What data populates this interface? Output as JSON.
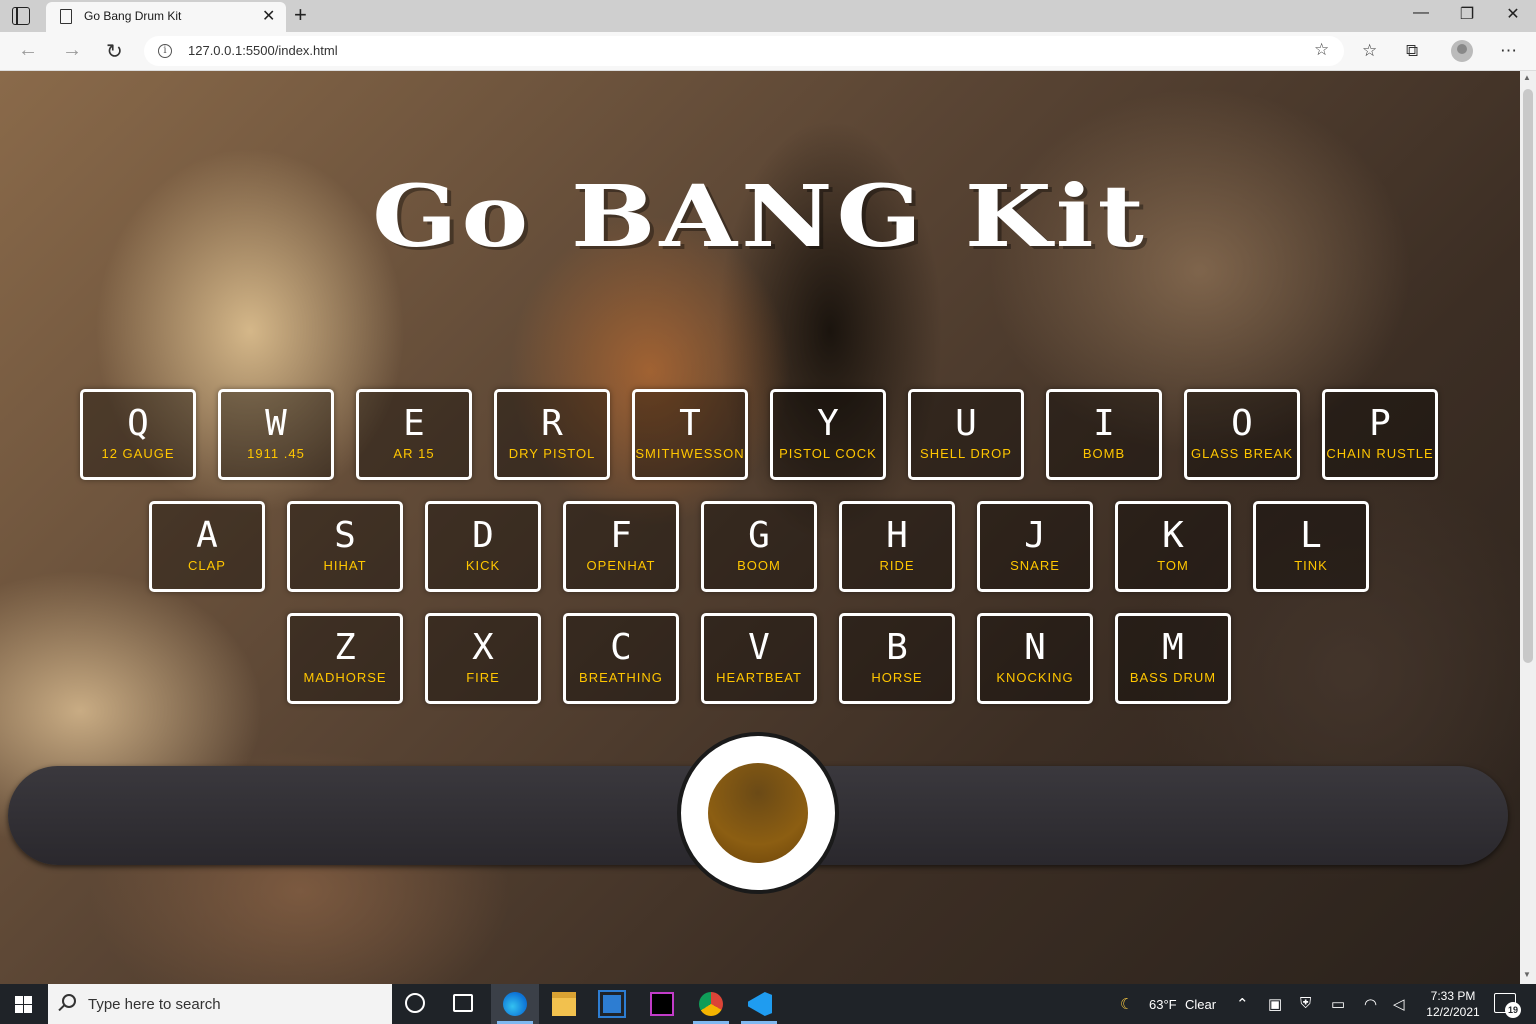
{
  "browser": {
    "tab_title": "Go Bang Drum Kit",
    "url": "127.0.0.1:5500/index.html",
    "close_tab": "✕",
    "new_tab": "+",
    "minimize": "—",
    "maximize": "❐",
    "close_window": "✕",
    "back": "←",
    "forward": "→",
    "refresh": "↻",
    "info": "i"
  },
  "page": {
    "title": "Go BANG Kit",
    "rows": [
      [
        {
          "key": "Q",
          "sound": "12 GAUGE"
        },
        {
          "key": "W",
          "sound": "1911 .45"
        },
        {
          "key": "E",
          "sound": "AR 15"
        },
        {
          "key": "R",
          "sound": "DRY PISTOL"
        },
        {
          "key": "T",
          "sound": "SMITHWESSON"
        },
        {
          "key": "Y",
          "sound": "PISTOL COCK"
        },
        {
          "key": "U",
          "sound": "SHELL DROP"
        },
        {
          "key": "I",
          "sound": "BOMB"
        },
        {
          "key": "O",
          "sound": "GLASS BREAK"
        },
        {
          "key": "P",
          "sound": "CHAIN RUSTLE"
        }
      ],
      [
        {
          "key": "A",
          "sound": "CLAP"
        },
        {
          "key": "S",
          "sound": "HIHAT"
        },
        {
          "key": "D",
          "sound": "KICK"
        },
        {
          "key": "F",
          "sound": "OPENHAT"
        },
        {
          "key": "G",
          "sound": "BOOM"
        },
        {
          "key": "H",
          "sound": "RIDE"
        },
        {
          "key": "J",
          "sound": "SNARE"
        },
        {
          "key": "K",
          "sound": "TOM"
        },
        {
          "key": "L",
          "sound": "TINK"
        }
      ],
      [
        {
          "key": "Z",
          "sound": "MADHORSE"
        },
        {
          "key": "X",
          "sound": "FIRE"
        },
        {
          "key": "C",
          "sound": "BREATHING"
        },
        {
          "key": "V",
          "sound": "HEARTBEAT"
        },
        {
          "key": "B",
          "sound": "HORSE"
        },
        {
          "key": "N",
          "sound": "KNOCKING"
        },
        {
          "key": "M",
          "sound": "BASS DRUM"
        }
      ]
    ],
    "slider": {
      "value_fraction": 0.5,
      "accent": "#8c5e12"
    }
  },
  "taskbar": {
    "search_placeholder": "Type here to search",
    "weather_temp": "63°F",
    "weather_text": "Clear",
    "time": "7:33 PM",
    "date": "12/2/2021",
    "notification_count": "19"
  },
  "colors": {
    "key_label": "#ffc600",
    "key_border": "#ffffff",
    "taskbar": "#1f2328"
  }
}
